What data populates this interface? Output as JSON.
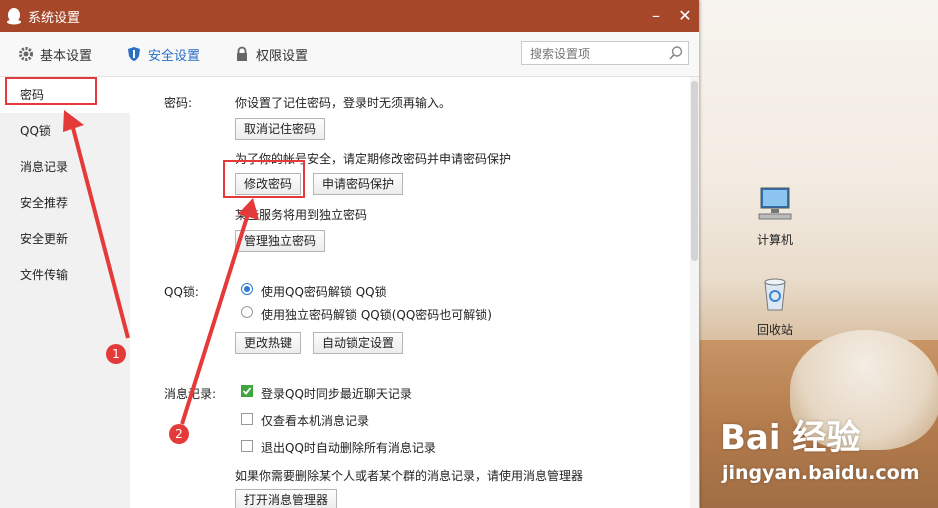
{
  "window": {
    "title": "系统设置",
    "minimize": "–",
    "close": "✕"
  },
  "tabs": [
    {
      "label": "基本设置",
      "icon": "gear-icon"
    },
    {
      "label": "安全设置",
      "icon": "shield-icon"
    },
    {
      "label": "权限设置",
      "icon": "lock-icon"
    }
  ],
  "search": {
    "placeholder": "搜索设置项"
  },
  "sidebar": {
    "items": [
      {
        "label": "密码"
      },
      {
        "label": "QQ锁"
      },
      {
        "label": "消息记录"
      },
      {
        "label": "安全推荐"
      },
      {
        "label": "安全更新"
      },
      {
        "label": "文件传输"
      }
    ]
  },
  "password": {
    "label": "密码:",
    "remember_text": "你设置了记住密码，登录时无须再输入。",
    "cancel_remember": "取消记住密码",
    "advice": "为了你的帐号安全，请定期修改密码并申请密码保护",
    "change_pwd": "修改密码",
    "apply_protect": "申请密码保护",
    "independent_text": "某些服务将用到独立密码",
    "manage_independent": "管理独立密码"
  },
  "qqlock": {
    "label": "QQ锁:",
    "option1": "使用QQ密码解锁 QQ锁",
    "option2": "使用独立密码解锁 QQ锁(QQ密码也可解锁)",
    "change_hotkey": "更改热键",
    "auto_lock": "自动锁定设置"
  },
  "messages": {
    "label": "消息记录:",
    "opt1": "登录QQ时同步最近聊天记录",
    "opt2": "仅查看本机消息记录",
    "opt3": "退出QQ时自动删除所有消息记录",
    "note": "如果你需要删除某个人或者某个群的消息记录，请使用消息管理器",
    "open_manager": "打开消息管理器"
  },
  "annotations": {
    "badge1": "1",
    "badge2": "2"
  },
  "desktop": {
    "icons": [
      {
        "label": "计算机"
      },
      {
        "label": "回收站"
      }
    ]
  },
  "watermark": {
    "line1": "Bai 经验",
    "line2": "jingyan.baidu.com"
  },
  "colors": {
    "titlebar": "#a7472a",
    "accent": "#2a6fc4",
    "annotation": "#e53a3a"
  }
}
